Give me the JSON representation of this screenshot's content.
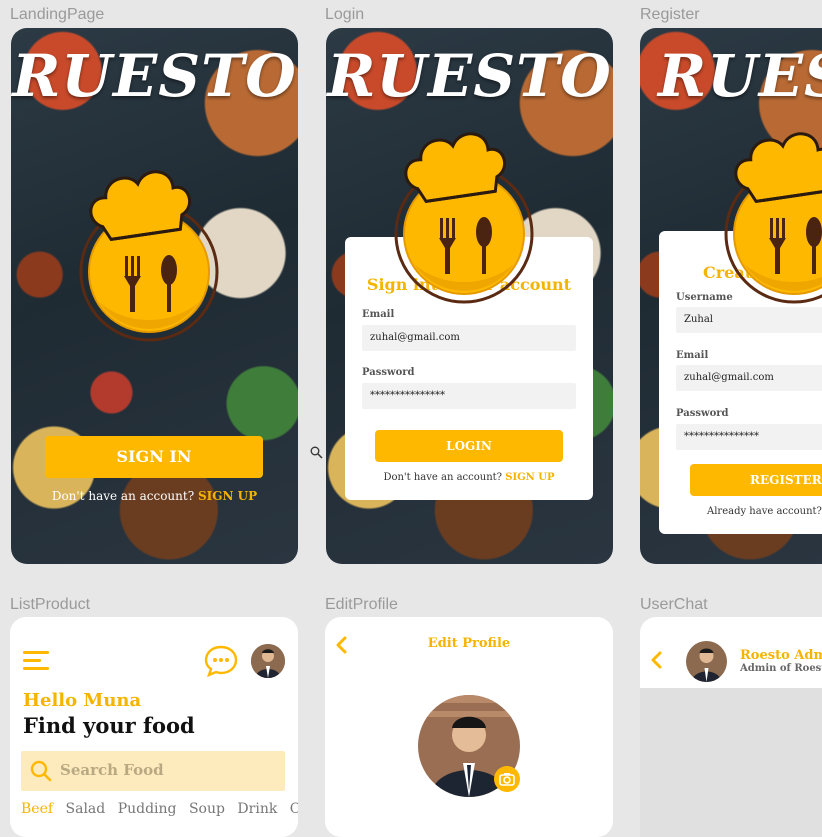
{
  "frames": {
    "landing": "LandingPage",
    "login": "Login",
    "register": "Register",
    "list_product": "ListProduct",
    "edit_profile": "EditProfile",
    "user_chat": "UserChat"
  },
  "brand": "RUESTO",
  "landing": {
    "sign_in": "SIGN IN",
    "no_account": "Don't have an account?",
    "sign_up": "SIGN UP"
  },
  "login": {
    "title": "Sign into your account",
    "email_label": "Email",
    "email_value": "zuhal@gmail.com",
    "password_label": "Password",
    "password_value": "***************",
    "login_button": "LOGIN",
    "no_account": "Don't have an account?",
    "sign_up": "SIGN UP"
  },
  "register": {
    "title": "Create new ac",
    "username_label": "Username",
    "username_value": "Zuhal",
    "email_label": "Email",
    "email_value": "zuhal@gmail.com",
    "password_label": "Password",
    "password_value": "***************",
    "register_button": "REGISTER",
    "have_account": "Already have account?"
  },
  "list_product": {
    "greeting": "Hello Muna",
    "headline": "Find your food",
    "search_placeholder": "Search Food",
    "categories": [
      "Beef",
      "Salad",
      "Pudding",
      "Soup",
      "Drink",
      "Cake"
    ]
  },
  "edit_profile": {
    "title": "Edit Profile"
  },
  "user_chat": {
    "name": "Roesto Admi",
    "subtitle": "Admin of Roesto"
  },
  "icons": [
    "zoom-cursor-icon",
    "chef-hat-logo",
    "hamburger-menu-icon",
    "chat-bubble-icon",
    "search-icon",
    "back-chevron-icon",
    "camera-icon"
  ],
  "colors": {
    "accent": "#ffb800",
    "accent_text": "#f5b400",
    "search_bg": "#fdebbd",
    "canvas": "#e7e7e7"
  }
}
